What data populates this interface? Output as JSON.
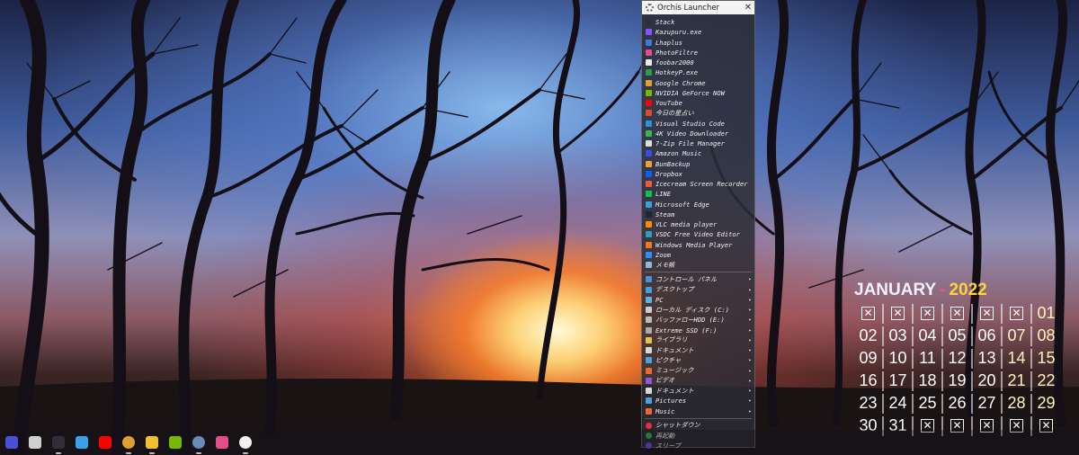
{
  "launcher": {
    "title": "Orchis Launcher",
    "close_glyph": "✕",
    "apps": [
      {
        "label": "Stack",
        "icon": "stack-icon",
        "color": "#2f2f3a"
      },
      {
        "label": "Kazupuru.exe",
        "icon": "kazupuru-icon",
        "color": "#8a4fff"
      },
      {
        "label": "Lhaplus",
        "icon": "lhaplus-icon",
        "color": "#3b7ad8"
      },
      {
        "label": "PhotoFiltre",
        "icon": "photofiltre-icon",
        "color": "#e44d8a"
      },
      {
        "label": "foobar2000",
        "icon": "foobar-icon",
        "color": "#e9e9e9"
      },
      {
        "label": "HotkeyP.exe",
        "icon": "hotkeyp-icon",
        "color": "#24a04a"
      },
      {
        "label": "Google Chrome",
        "icon": "chrome-icon",
        "color": "#e0a030"
      },
      {
        "label": "NVIDIA GeForce NOW",
        "icon": "nvidia-icon",
        "color": "#76b900"
      },
      {
        "label": "YouTube",
        "icon": "youtube-icon",
        "color": "#ff0000"
      },
      {
        "label": "今日の星占い",
        "icon": "horoscope-icon",
        "color": "#d94c2f"
      },
      {
        "label": "Visual Studio Code",
        "icon": "vscode-icon",
        "color": "#2c8fe0"
      },
      {
        "label": "4K Video Downloader",
        "icon": "4k-downloader-icon",
        "color": "#3bb54a"
      },
      {
        "label": "7-Zip File Manager",
        "icon": "7zip-icon",
        "color": "#dddddd"
      },
      {
        "label": "Amazon Music",
        "icon": "amazon-music-icon",
        "color": "#3a4cf0"
      },
      {
        "label": "BunBackup",
        "icon": "bunbackup-icon",
        "color": "#e8a03a"
      },
      {
        "label": "Dropbox",
        "icon": "dropbox-icon",
        "color": "#0061fe"
      },
      {
        "label": "Icecream Screen Recorder",
        "icon": "icecream-icon",
        "color": "#f0583a"
      },
      {
        "label": "LINE",
        "icon": "line-icon",
        "color": "#06c755"
      },
      {
        "label": "Microsoft Edge",
        "icon": "edge-icon",
        "color": "#2fa4d8"
      },
      {
        "label": "Steam",
        "icon": "steam-icon",
        "color": "#1b2838"
      },
      {
        "label": "VLC media player",
        "icon": "vlc-icon",
        "color": "#ff8800"
      },
      {
        "label": "VSDC Free Video Editor",
        "icon": "vsdc-icon",
        "color": "#2aa0b8"
      },
      {
        "label": "Windows Media Player",
        "icon": "wmp-icon",
        "color": "#f07a20"
      },
      {
        "label": "Zoom",
        "icon": "zoom-icon",
        "color": "#2d8cff"
      },
      {
        "label": "メモ帳",
        "icon": "notepad-icon",
        "color": "#8fb8d8"
      }
    ],
    "places": [
      {
        "label": "コントロール パネル",
        "icon": "control-panel-icon",
        "color": "#4b8fd6",
        "has_arrow": true
      },
      {
        "label": "デスクトップ",
        "icon": "desktop-icon",
        "color": "#3ba0e6",
        "has_arrow": true
      },
      {
        "label": "PC",
        "icon": "pc-icon",
        "color": "#5ab0e8",
        "has_arrow": true
      },
      {
        "label": "ローカル ディスク (C:)",
        "icon": "drive-c-icon",
        "color": "#cccccc",
        "has_arrow": true
      },
      {
        "label": "バッファローHDD (E:)",
        "icon": "drive-e-icon",
        "color": "#bbbbbb",
        "has_arrow": true
      },
      {
        "label": "Extreme SSD (F:)",
        "icon": "drive-f-icon",
        "color": "#aaaaaa",
        "has_arrow": true
      },
      {
        "label": "ライブラリ",
        "icon": "library-icon",
        "color": "#e8c050",
        "has_arrow": true
      },
      {
        "label": "ドキュメント",
        "icon": "documents-icon",
        "color": "#d8d8d8",
        "has_arrow": true
      },
      {
        "label": "ピクチャ",
        "icon": "pictures-icon",
        "color": "#4aa0e0",
        "has_arrow": true
      },
      {
        "label": "ミュージック",
        "icon": "music-icon",
        "color": "#e86a30",
        "has_arrow": true
      },
      {
        "label": "ビデオ",
        "icon": "videos-icon",
        "color": "#8a5ad8",
        "has_arrow": true
      },
      {
        "label": "ドキュメント",
        "icon": "documents-icon",
        "color": "#d8d8d8",
        "has_arrow": true
      },
      {
        "label": "Pictures",
        "icon": "pictures-icon",
        "color": "#4aa0e0",
        "has_arrow": true
      },
      {
        "label": "Music",
        "icon": "music-icon",
        "color": "#e86a30",
        "has_arrow": true
      }
    ],
    "power": [
      {
        "label": "シャットダウン",
        "icon": "shutdown-icon",
        "color": "#e8303a"
      },
      {
        "label": "再起動",
        "icon": "restart-icon",
        "color": "#2fb050"
      },
      {
        "label": "スリープ",
        "icon": "sleep-icon",
        "color": "#6a4ae0"
      }
    ]
  },
  "calendar": {
    "month": "JANUARY",
    "separator": "-",
    "year": "2022",
    "empty_glyph": "✕",
    "weeks": [
      [
        "",
        "",
        "",
        "",
        "",
        "",
        "01"
      ],
      [
        "02",
        "03",
        "04",
        "05",
        "06",
        "07",
        "08"
      ],
      [
        "09",
        "10",
        "11",
        "12",
        "13",
        "14",
        "15"
      ],
      [
        "16",
        "17",
        "18",
        "19",
        "20",
        "21",
        "22"
      ],
      [
        "23",
        "24",
        "25",
        "26",
        "27",
        "28",
        "29"
      ],
      [
        "30",
        "31",
        "",
        "",
        "",
        "",
        ""
      ]
    ]
  },
  "taskbar": {
    "items": [
      {
        "icon": "start-icon",
        "color": "#4a4fd8",
        "running": false
      },
      {
        "icon": "task-view-icon",
        "color": "#d0d0d0",
        "running": false
      },
      {
        "icon": "stack-icon",
        "color": "#2f2f3a",
        "running": true
      },
      {
        "icon": "notepad-icon",
        "color": "#3aa0e8",
        "running": false
      },
      {
        "icon": "youtube-icon",
        "color": "#ff0000",
        "running": false
      },
      {
        "icon": "chrome-icon",
        "color": "#e0a030",
        "running": true
      },
      {
        "icon": "file-explorer-icon",
        "color": "#f0c030",
        "running": true
      },
      {
        "icon": "nvidia-icon",
        "color": "#76b900",
        "running": false
      },
      {
        "icon": "settings-icon",
        "color": "#6a8ab8",
        "running": true
      },
      {
        "icon": "photofiltre-icon",
        "color": "#e44d8a",
        "running": false
      },
      {
        "icon": "orchis-icon",
        "color": "#f0f0f0",
        "running": true
      }
    ]
  }
}
